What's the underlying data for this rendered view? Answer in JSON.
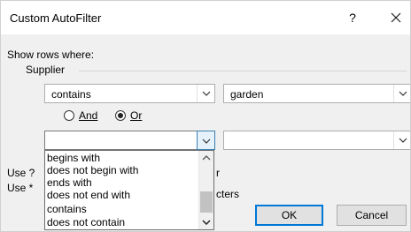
{
  "dialog": {
    "title": "Custom AutoFilter",
    "help_label": "?",
    "show_rows_label": "Show rows where:",
    "field_label": "Supplier"
  },
  "criteria1": {
    "operator": "contains",
    "value": "garden"
  },
  "logic": {
    "and_label": "And",
    "and_selected": false,
    "or_label": "Or",
    "or_selected": true
  },
  "criteria2": {
    "operator": "",
    "value": ""
  },
  "dropdown_options": [
    "begins with",
    "does not begin with",
    "ends with",
    "does not end with",
    "contains",
    "does not contain"
  ],
  "hints": {
    "line1_prefix": "Use ?",
    "line1_suffix": "r",
    "line2_prefix": "Use *",
    "line2_suffix": "cters"
  },
  "buttons": {
    "ok": "OK",
    "cancel": "Cancel"
  },
  "icons": {
    "close": "close-icon",
    "dropdown_arrow": "chevron-down-icon",
    "scroll_up": "scroll-up-arrow-icon",
    "scroll_down": "scroll-down-arrow-icon"
  },
  "colors": {
    "dialog_bg": "#f0f0f0",
    "titlebar_bg": "#ffffff",
    "focus_blue": "#0078d7",
    "focused_arrow_bg": "#e5f1fb"
  }
}
